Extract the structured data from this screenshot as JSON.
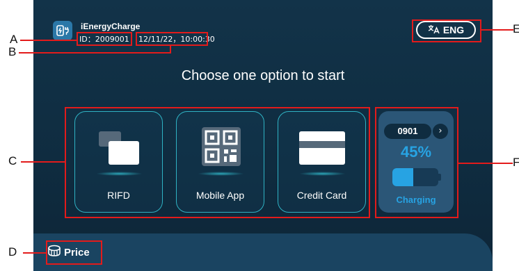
{
  "app": {
    "brand": "iEnergyCharge",
    "station_id": "ID：2009001",
    "datetime": "12/11/22，10:00:30",
    "language_label": "ENG",
    "language_icon": "translate-icon"
  },
  "main": {
    "heading": "Choose one option to start",
    "options": [
      {
        "label": "RIFD",
        "icon": "rfid-card-icon"
      },
      {
        "label": "Mobile App",
        "icon": "qr-code-icon"
      },
      {
        "label": "Credit Card",
        "icon": "credit-card-icon"
      }
    ]
  },
  "status": {
    "connector_id": "0901",
    "next_icon": "chevron-right-icon",
    "progress_text": "45%",
    "progress_value": 45,
    "state": "Charging"
  },
  "footer": {
    "price_label": "Price",
    "price_icon": "coins-icon"
  },
  "annotations": [
    "A",
    "B",
    "C",
    "D",
    "E",
    "F"
  ],
  "colors": {
    "accent": "#27a3e3",
    "border": "#2fb3c4",
    "background": "#123349",
    "annotation": "#e31b1b"
  }
}
